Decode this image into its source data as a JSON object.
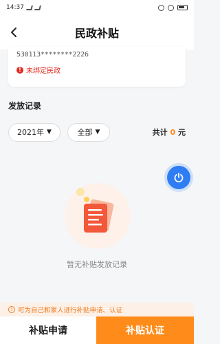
{
  "status_bar": {
    "time": "14:37",
    "signal_icon": "signal-icon",
    "battery_icon": "battery-icon"
  },
  "nav": {
    "title": "民政补贴",
    "back_icon": "chevron-left-icon"
  },
  "account_card": {
    "id_number": "530113********2226",
    "bind_status": "未绑定民政",
    "bind_status_color": "#e02c1f"
  },
  "records": {
    "section_title": "发放记录",
    "year_filter": "2021年",
    "type_filter": "全部",
    "total_prefix": "共计",
    "total_amount": "0",
    "total_unit": "元",
    "accent_color": "#ff8a1f"
  },
  "empty_state": {
    "text": "暂无补贴发放记录",
    "icon": "empty-document-icon"
  },
  "float_button": {
    "icon": "power-icon",
    "color": "#2e7df5"
  },
  "tip": {
    "text": "可为自己和家人进行补贴申请、认证"
  },
  "bottom": {
    "apply_label": "补贴申请",
    "certify_label": "补贴认证",
    "primary_color": "#ff8c1a"
  }
}
